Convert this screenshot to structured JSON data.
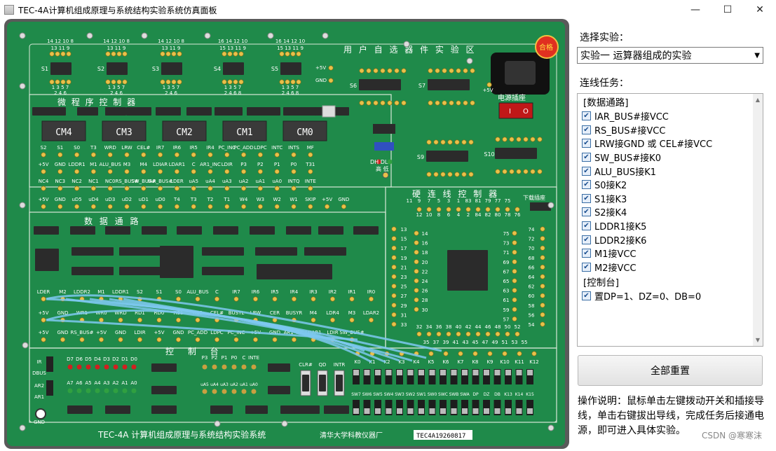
{
  "window": {
    "title": "TEC-4A计算机组成原理与系统结构实验系统仿真面板",
    "minimize": "—",
    "maximize": "☐",
    "close": "✕"
  },
  "board": {
    "cm_labels": [
      "CM4",
      "CM3",
      "CM2",
      "CM1",
      "CM0"
    ],
    "section_micro": "微  程  序  控  制  器",
    "section_data": "数  据  通  路",
    "section_ctrl": "控  制  台",
    "section_user": "用 户 自 选 器 件 实 验 区",
    "section_hard": "硬 连 线 控 制 器",
    "power_socket": "电源插座",
    "power_on": "I",
    "power_off": "O",
    "qualified": "合格",
    "footer_title": "TEC-4A 计算机组成原理与系统结构实验系统",
    "footer_maker": "清华大学科教仪器厂",
    "serial": "TEC4A19260817",
    "download_socket": "下载插座",
    "dh_dl": "DH  DL",
    "gao_di": "高  低",
    "micro_row1": [
      "S2",
      "S1",
      "S0",
      "T3",
      "WRD",
      "LRW",
      "CEL#",
      "IR7",
      "IR6",
      "IR5",
      "IR4",
      "PC_INC",
      "PC_ADD",
      "LDPC",
      "INTC",
      "INTS",
      "MF"
    ],
    "micro_row2": [
      "+5V",
      "GND",
      "LDDR1",
      "M1",
      "ALU_BUS",
      "M3",
      "M4",
      "LDIAR",
      "LDAR1",
      "C",
      "AR1_INC",
      "LDIR",
      "P3",
      "P2",
      "P1",
      "P0",
      "T31"
    ],
    "micro_row3": [
      "NC4",
      "NC3",
      "NC2",
      "NC1",
      "NC0",
      "RS_BUS#",
      "SW_BUS#",
      "IAR_BUS#",
      "LDER",
      "uA5",
      "uA4",
      "uA3",
      "uA2",
      "uA1",
      "uA0",
      "INTQ",
      "INTE"
    ],
    "micro_row4": [
      "+5V",
      "GND",
      "uD5",
      "uD4",
      "uD3",
      "uD2",
      "uD1",
      "uD0",
      "T4",
      "T3",
      "T2",
      "T1",
      "W4",
      "W3",
      "W2",
      "W1",
      "SKIP",
      "+5V",
      "GND"
    ],
    "data_row1": [
      "LDER",
      "M2",
      "LDDR2",
      "M1",
      "LDDR1",
      "S2",
      "S1",
      "S0",
      "ALU_BUS",
      "C",
      "IR7",
      "IR6",
      "IR5",
      "IR4",
      "IR3",
      "IR2",
      "IR1",
      "IR0"
    ],
    "data_row2": [
      "+5V",
      "GND",
      "WR1",
      "WR0",
      "WRD",
      "RD1",
      "RD0",
      "RS1",
      "RS0",
      "CEL#",
      "BUSYL",
      "LRW",
      "CER",
      "BUSYR",
      "M4",
      "LDR4",
      "M3",
      "LDAR2"
    ],
    "data_row3": [
      "+5V",
      "GND",
      "RS_BUS#",
      "+5V",
      "GND",
      "LDIR",
      "+5V",
      "GND",
      "PC_ADD",
      "LDPC",
      "PC_INC",
      "+5V",
      "GND",
      "AR1_INC",
      "LDAR1",
      "LDIR",
      "SW_BUS#"
    ],
    "ctrl_d": [
      "D7",
      "D6",
      "D5",
      "D4",
      "D3",
      "D2",
      "D1",
      "D0"
    ],
    "ctrl_a": [
      "A7",
      "A6",
      "A5",
      "A4",
      "A3",
      "A2",
      "A1",
      "A0"
    ],
    "ctrl_left": [
      "IR",
      "DBUS",
      "AR2",
      "AR1",
      "GND"
    ],
    "ctrl_p": [
      "P3",
      "P2",
      "P1",
      "P0",
      "C",
      "INTE"
    ],
    "ctrl_ua": [
      "uA5",
      "uA4",
      "uA3",
      "uA2",
      "uA1",
      "uA0"
    ],
    "ctrl_k": [
      "K0",
      "K1",
      "K2",
      "K3",
      "K4",
      "K5",
      "K6",
      "K7",
      "K8",
      "K9",
      "K10",
      "K11",
      "K12"
    ],
    "ctrl_sw": [
      "SW7",
      "SW6",
      "SW5",
      "SW4",
      "SW3",
      "SW2",
      "SW1",
      "SW0",
      "SWC",
      "SWB",
      "SWA",
      "DP",
      "DZ",
      "DB",
      "K13",
      "K14",
      "K15"
    ],
    "ctrl_buttons": [
      "CLR#",
      "QD",
      "INTR"
    ],
    "hard_left": [
      "13",
      "15",
      "17",
      "19",
      "21",
      "23",
      "25",
      "27",
      "29",
      "31",
      "33"
    ],
    "hard_left2": [
      "14",
      "16",
      "18",
      "20",
      "22",
      "24",
      "26",
      "28",
      "30"
    ],
    "hard_right": [
      "74",
      "72",
      "70",
      "68",
      "66",
      "64",
      "62",
      "60",
      "58",
      "56",
      "54"
    ],
    "hard_right2": [
      "75",
      "73",
      "71",
      "69",
      "67",
      "65",
      "63",
      "61",
      "59",
      "57"
    ],
    "hard_top": [
      "11",
      "9",
      "7",
      "5",
      "3",
      "1",
      "83",
      "81",
      "79",
      "77",
      "75"
    ],
    "hard_top2": [
      "12",
      "10",
      "8",
      "6",
      "4",
      "2",
      "84",
      "82",
      "80",
      "78",
      "76"
    ],
    "hard_bottom": [
      "32",
      "34",
      "36",
      "38",
      "40",
      "42",
      "44",
      "46",
      "48",
      "50",
      "52"
    ],
    "hard_bottom2": [
      "35",
      "37",
      "39",
      "41",
      "43",
      "45",
      "47",
      "49",
      "51",
      "53",
      "55"
    ],
    "s_labels": [
      "S1",
      "S2",
      "S3",
      "S4",
      "S5"
    ],
    "s_top_pins": [
      "14 12 10 8",
      "14 12 10 8",
      "14 12 10 8",
      "16 14 12 10",
      "16 14 12 10"
    ],
    "s_top_pins2": [
      "13 11 9",
      "13 11 9",
      "13 11 9",
      "15 13 11 9",
      "15 13 11 9"
    ],
    "s_bot_pins": [
      "1 3 5 7",
      "1 3 5 7",
      "1 3 5 7",
      "1 3 5 7",
      "1 3 5 7"
    ],
    "s_bot_pins2": [
      "2 4 6",
      "2 4 6",
      "2 4 6",
      "2 4 6 8",
      "2 4 6 8"
    ],
    "user_labels": [
      "S6",
      "S7",
      "S9",
      "S10"
    ],
    "plus5v": "+5V",
    "gnd": "GND"
  },
  "panel": {
    "select_label": "选择实验：",
    "select_value": "实验一  运算器组成的实验",
    "tasks_label": "连线任务：",
    "groups": [
      {
        "name": "[数据通路]",
        "items": [
          "IAR_BUS#接VCC",
          "RS_BUS#接VCC",
          "LRW接GND 或 CEL#接VCC",
          "SW_BUS#接K0",
          "ALU_BUS接K1",
          "S0接K2",
          "S1接K3",
          "S2接K4",
          "LDDR1接K5",
          "LDDR2接K6",
          "M1接VCC",
          "M2接VCC"
        ]
      },
      {
        "name": "[控制台]",
        "items": [
          "置DP=1、DZ=0、DB=0"
        ]
      }
    ],
    "reset_button": "全部重置",
    "help_text": "操作说明：鼠标单击左键拨动开关和插接导线，单击右键拔出导线，完成任务后接通电源，即可进入具体实验。",
    "watermark": "CSDN @寒寒沫"
  },
  "colors": {
    "board_green": "#1f8a4a",
    "chip": "#2b2b2b",
    "pin": "#e8c14a",
    "wire": "#7ec8f0",
    "led_red": "#d02020",
    "led_green": "#30a040"
  }
}
